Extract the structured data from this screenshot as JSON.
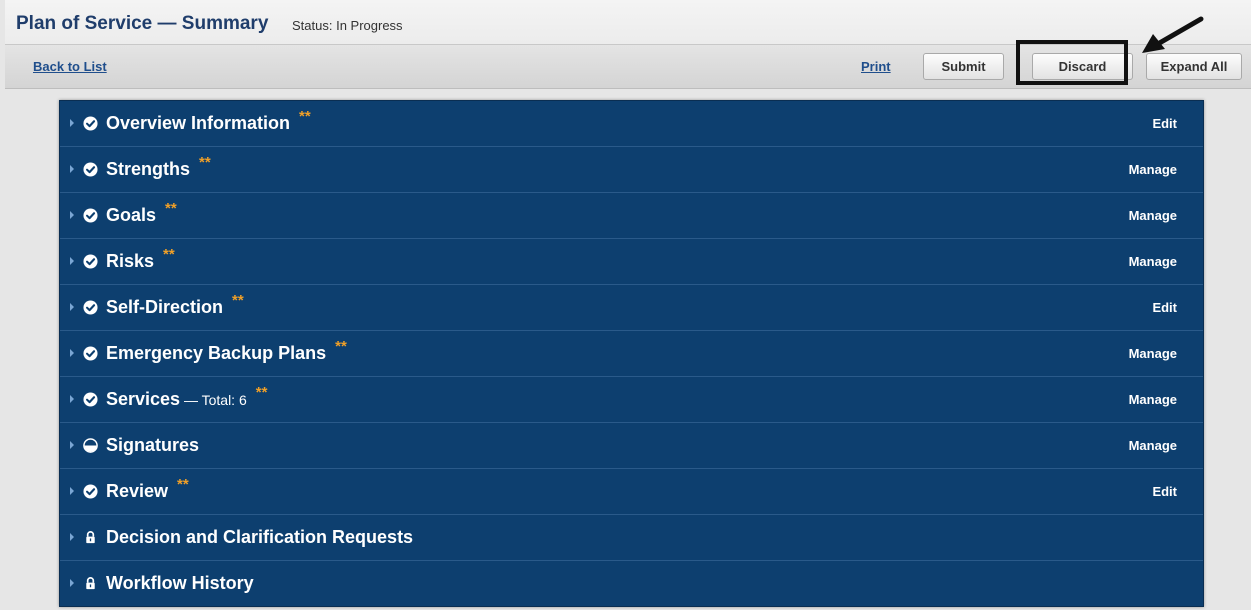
{
  "header": {
    "title": "Plan of Service — Summary",
    "status": "Status: In Progress"
  },
  "toolbar": {
    "back_label": "Back to List",
    "print_label": "Print",
    "submit_label": "Submit",
    "discard_label": "Discard",
    "expand_label": "Expand All"
  },
  "sections": [
    {
      "title": "Overview Information",
      "subtext": "",
      "stars": "**",
      "status_icon": "check-circle-icon",
      "action": "Edit"
    },
    {
      "title": "Strengths",
      "subtext": "",
      "stars": "**",
      "status_icon": "check-circle-icon",
      "action": "Manage"
    },
    {
      "title": "Goals",
      "subtext": "",
      "stars": "**",
      "status_icon": "check-circle-icon",
      "action": "Manage"
    },
    {
      "title": "Risks",
      "subtext": "",
      "stars": "**",
      "status_icon": "check-circle-icon",
      "action": "Manage"
    },
    {
      "title": "Self-Direction",
      "subtext": "",
      "stars": "**",
      "status_icon": "check-circle-icon",
      "action": "Edit"
    },
    {
      "title": "Emergency Backup Plans",
      "subtext": "",
      "stars": "**",
      "status_icon": "check-circle-icon",
      "action": "Manage"
    },
    {
      "title": "Services",
      "subtext": " — Total: 6",
      "stars": "**",
      "status_icon": "check-circle-icon",
      "action": "Manage"
    },
    {
      "title": "Signatures",
      "subtext": "",
      "stars": "",
      "status_icon": "half-circle-icon",
      "action": "Manage"
    },
    {
      "title": "Review",
      "subtext": "",
      "stars": "**",
      "status_icon": "check-circle-icon",
      "action": "Edit"
    },
    {
      "title": "Decision and Clarification Requests",
      "subtext": "",
      "stars": "",
      "status_icon": "lock-icon",
      "action": ""
    },
    {
      "title": "Workflow History",
      "subtext": "",
      "stars": "",
      "status_icon": "lock-icon",
      "action": ""
    }
  ],
  "colors": {
    "panel": "#0d3f6f",
    "star": "#f0a028",
    "title": "#1f3d6b",
    "link": "#1f4e8c"
  }
}
